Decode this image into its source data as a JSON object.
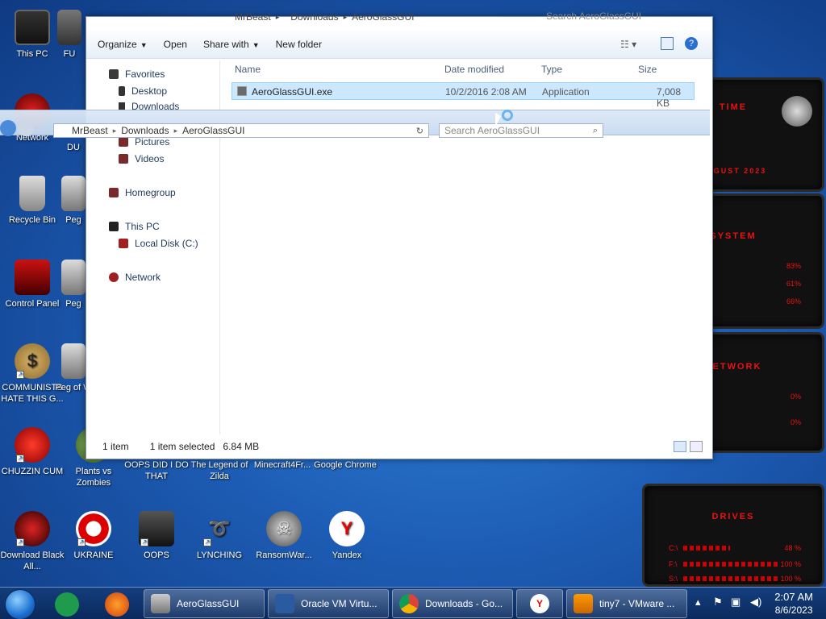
{
  "desktop_icons": [
    {
      "label": "This PC",
      "icon": "computer-icon"
    },
    {
      "label": "Network",
      "icon": "network-icon"
    },
    {
      "label": "Recycle Bin",
      "icon": "recycle-bin-icon"
    },
    {
      "label": "Control Panel",
      "icon": "control-panel-icon"
    },
    {
      "label": "COMMUNISTS HATE THIS G...",
      "icon": "money-bag-icon"
    },
    {
      "label": "CHUZZIN CUM",
      "icon": "chuzzle-icon"
    },
    {
      "label": "Download Black All...",
      "icon": "black-ball-icon"
    },
    {
      "label": "UKRAINE",
      "icon": "radiation-icon"
    },
    {
      "label": "OOPS",
      "icon": "oops-icon"
    },
    {
      "label": "LYNCHING",
      "icon": "noose-icon"
    },
    {
      "label": "RansomWar...",
      "icon": "skull-icon"
    },
    {
      "label": "Yandex",
      "icon": "yandex-icon"
    },
    {
      "label": "Plants vs Zombies",
      "icon": "plants-icon"
    },
    {
      "label": "OOPS DID I DO THAT",
      "icon": "oops2-icon"
    },
    {
      "label": "The Legend of Zilda",
      "icon": "zelda-icon"
    },
    {
      "label": "Minecraft4Fr...",
      "icon": "minecraft-icon"
    },
    {
      "label": "Google Chrome",
      "icon": "chrome-icon"
    },
    {
      "label": "FU",
      "icon": "folder-icon"
    },
    {
      "label": "DU",
      "icon": "folder-icon"
    },
    {
      "label": "Peg",
      "icon": "peg-icon"
    },
    {
      "label": "Peg",
      "icon": "peg-icon"
    },
    {
      "label": "Peg of W",
      "icon": "peg-icon"
    }
  ],
  "explorer": {
    "top_breadcrumb": [
      "MrBeast",
      "Downloads",
      "AeroGlassGUI"
    ],
    "top_search_placeholder": "Search AeroGlassGUI",
    "commands": {
      "organize": "Organize",
      "open": "Open",
      "share_with": "Share with",
      "new_folder": "New folder"
    },
    "nav": {
      "favorites": "Favorites",
      "desktop": "Desktop",
      "downloads": "Downloads",
      "pictures": "Pictures",
      "videos": "Videos",
      "homegroup": "Homegroup",
      "this_pc": "This PC",
      "local_disk": "Local Disk (C:)",
      "network": "Network"
    },
    "columns": {
      "name": "Name",
      "date": "Date modified",
      "type": "Type",
      "size": "Size"
    },
    "files": [
      {
        "name": "AeroGlassGUI.exe",
        "date": "10/2/2016 2:08 AM",
        "type": "Application",
        "size": "7,008 KB"
      }
    ],
    "status": {
      "count": "1 item",
      "selected": "1 item selected",
      "size": "6.84 MB"
    }
  },
  "ghost_window": {
    "breadcrumb": [
      "MrBeast",
      "Downloads",
      "AeroGlassGUI"
    ],
    "search_placeholder": "Search AeroGlassGUI"
  },
  "gadgets": {
    "time": {
      "title": "TIME",
      "date_line": "AUGUST 2023"
    },
    "system": {
      "title": "SYSTEM",
      "values": [
        "83%",
        "61%",
        "66%"
      ]
    },
    "network": {
      "title": "NETWORK",
      "values": [
        "0%",
        "0%"
      ]
    },
    "drives": {
      "title": "DRIVES",
      "rows": [
        {
          "label": "C:\\",
          "value": "48 %",
          "fill": 0.48
        },
        {
          "label": "F:\\",
          "value": "100 %",
          "fill": 1.0
        },
        {
          "label": "S:\\",
          "value": "100 %",
          "fill": 1.0
        }
      ]
    }
  },
  "taskbar": {
    "buttons": [
      {
        "label": "AeroGlassGUI",
        "icon": "folder-icon"
      },
      {
        "label": "Oracle VM Virtu...",
        "icon": "virtualbox-icon"
      },
      {
        "label": "Downloads - Go...",
        "icon": "chrome-icon"
      },
      {
        "label": "",
        "icon": "yandex-icon"
      },
      {
        "label": "tiny7 - VMware ...",
        "icon": "vmware-icon"
      }
    ],
    "clock_time": "2:07 AM",
    "clock_date": "8/6/2023",
    "colors": {
      "accent": "#1a6fd0",
      "gadget_red": "#e11111"
    }
  }
}
